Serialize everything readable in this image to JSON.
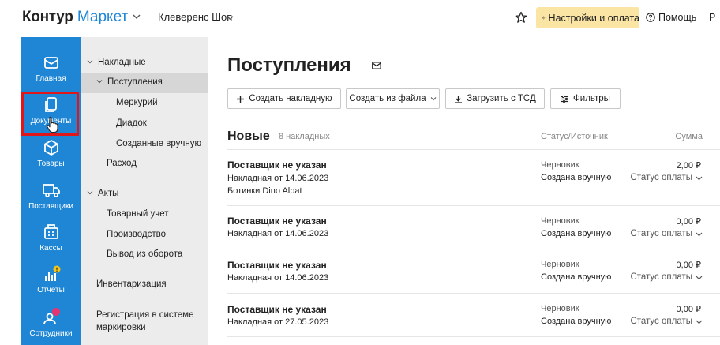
{
  "header": {
    "logo_part1": "Контур",
    "logo_part2": "Маркет",
    "org_name": "Клеверенс Шоп",
    "settings_label": "Настройки и оплата",
    "help_label": "Помощь",
    "user_initial": "Р"
  },
  "leftnav": {
    "items": [
      {
        "label": "Главная",
        "icon": "home-icon"
      },
      {
        "label": "Документы",
        "icon": "documents-icon"
      },
      {
        "label": "Товары",
        "icon": "box-icon"
      },
      {
        "label": "Поставщики",
        "icon": "truck-icon"
      },
      {
        "label": "Кассы",
        "icon": "register-icon"
      },
      {
        "label": "Отчеты",
        "icon": "chart-icon"
      },
      {
        "label": "Сотрудники",
        "icon": "people-icon"
      }
    ]
  },
  "sidebar": {
    "nakladnye": "Накладные",
    "postupleniya": "Поступления",
    "merkuriy": "Меркурий",
    "diadok": "Диадок",
    "created_manual": "Созданные вручную",
    "rashod": "Расход",
    "akty": "Акты",
    "tovarny_uchet": "Товарный учет",
    "proizvodstvo": "Производство",
    "vyvod": "Вывод из оборота",
    "inventarizatsiya": "Инвентаризация",
    "registratsiya_1": "Регистрация в системе",
    "registratsiya_2": "маркировки"
  },
  "main": {
    "title": "Поступления",
    "toolbar": {
      "create": "Создать накладную",
      "from_file": "Создать из файла",
      "upload_tsd": "Загрузить с ТСД",
      "filters": "Фильтры"
    },
    "section_title": "Новые",
    "section_count": "8 накладных",
    "col_status": "Статус/Источник",
    "col_sum": "Сумма",
    "rows": [
      {
        "supplier": "Поставщик не указан",
        "doc": "Накладная от 14.06.2023",
        "note": "Ботинки Dino Albat",
        "status": "Черновик",
        "source": "Создана вручную",
        "sum": "2,00 ₽",
        "pay": "Статус оплаты"
      },
      {
        "supplier": "Поставщик не указан",
        "doc": "Накладная от 14.06.2023",
        "note": "",
        "status": "Черновик",
        "source": "Создана вручную",
        "sum": "0,00 ₽",
        "pay": "Статус оплаты"
      },
      {
        "supplier": "Поставщик не указан",
        "doc": "Накладная от 14.06.2023",
        "note": "",
        "status": "Черновик",
        "source": "Создана вручную",
        "sum": "0,00 ₽",
        "pay": "Статус оплаты"
      },
      {
        "supplier": "Поставщик не указан",
        "doc": "Накладная от 27.05.2023",
        "note": "",
        "status": "Черновик",
        "source": "Создана вручную",
        "sum": "0,00 ₽",
        "pay": "Статус оплаты"
      }
    ]
  },
  "colors": {
    "brand_blue": "#1f86d6",
    "settings_yellow": "#fbe5a4",
    "highlight_red": "#e0161b",
    "sidebar_gray": "#ececec"
  }
}
